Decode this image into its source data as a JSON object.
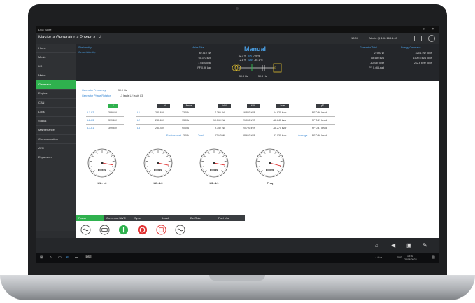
{
  "window": {
    "app_name": "DSE Suite",
    "minimize": "–",
    "maximize": "□",
    "close": "✕"
  },
  "topbar": {
    "breadcrumb": "Master > Generator > Power > L-L",
    "time": "13:00",
    "user": "Admin @ 192.168.1.63"
  },
  "sidebar": {
    "items": [
      {
        "label": "Home"
      },
      {
        "label": "Mimic"
      },
      {
        "label": "I/O"
      },
      {
        "label": "Mains"
      },
      {
        "label": "Generator",
        "active": true
      },
      {
        "label": "Engine"
      },
      {
        "label": "CAN"
      },
      {
        "label": "Logs"
      },
      {
        "label": "Status"
      },
      {
        "label": "Maintenance"
      },
      {
        "label": "Communication"
      },
      {
        "label": "AVR"
      },
      {
        "label": "Expansion"
      }
    ]
  },
  "header": {
    "site_identity": "Site identity:",
    "genset_identity": "Genset identity:",
    "mains_total_label": "Mains Total",
    "mains_total": [
      "62.510 kW",
      "65.370 kVA",
      "17.550 kvar",
      "PF 0.96 Lag"
    ],
    "mode": "Manual",
    "mimic_values": [
      "32.7 %",
      "kW",
      "7.9 %",
      "12.1 %",
      "kvar",
      "-30.1 %"
    ],
    "mimic_labels": {
      "hz_left": "50.3 Hz",
      "hz_right": "50.3 Hz",
      "gen": "G"
    },
    "generator_total_label": "Generator Total",
    "generator_total": [
      "27540 W",
      "58.660 kVA",
      "-52.030 kvar",
      "PF 0.46 Lead"
    ],
    "energy_label": "Energy Generator",
    "energy": [
      "425.1 kW hour",
      "1500.6 kVA hour",
      "212.6 kvar hour"
    ]
  },
  "main": {
    "freq_label": "Generator Frequency",
    "freq_value": "50.0 Hz",
    "phase_label": "Generator Phase Rotation",
    "phase_value": "L1 leads L2 leads L3",
    "ll_header": "L-L",
    "ll_rows": [
      {
        "label": "L1-L2",
        "value": "399.4 V"
      },
      {
        "label": "L2-L3",
        "value": "399.6 V"
      },
      {
        "label": "L3-L1",
        "value": "399.5 V"
      }
    ],
    "table_headers": [
      "L-N",
      "Amps",
      "kW",
      "kVA",
      "kvar",
      "pF"
    ],
    "rows": [
      {
        "phase": "L1",
        "ln": "230.6 V",
        "amps": "73.0 A",
        "kw": "7.760 kW",
        "kva": "16.820 kVA",
        "kvar": "-14.920 kvar",
        "pf": "PF 0.46 Lead"
      },
      {
        "phase": "L2",
        "ln": "230.6 V",
        "amps": "93.0 A",
        "kw": "10.040 kW",
        "kva": "21.060 kVA",
        "kvar": "-18.640 kvar",
        "pf": "PF 0.47 Lead"
      },
      {
        "phase": "L3",
        "ln": "230.4 V",
        "amps": "90.0 A",
        "kw": "9.740 kW",
        "kva": "20.700 kVA",
        "kvar": "-18.270 kvar",
        "pf": "PF 0.47 Lead"
      }
    ],
    "earth_label": "Earth current",
    "earth_value": "3.0 A",
    "total_label": "Total",
    "total_kw": "27540 W",
    "total_kva": "58.660 kVA",
    "total_kvar": "-52.030 kvar",
    "average_label": "Average",
    "average_pf": "PF 0.46 Lead",
    "gauges": [
      {
        "label": "L1 - L2",
        "readout": "399.4 V"
      },
      {
        "label": "L2 - L3",
        "readout": "399.6 V"
      },
      {
        "label": "L3 - L1",
        "readout": "399.5 V"
      },
      {
        "label": "Freq",
        "readout": "50.0 Hz"
      }
    ]
  },
  "tabs": [
    {
      "label": "Power",
      "active": true
    },
    {
      "label": "Governor / AVR"
    },
    {
      "label": "Sync"
    },
    {
      "label": "Load"
    },
    {
      "label": "De-Rate"
    },
    {
      "label": "Fuel Use"
    }
  ],
  "controls": [
    "mains-icon",
    "auto-icon",
    "start-icon",
    "stop-icon",
    "manual-icon",
    "generator-icon"
  ],
  "taskbar": {
    "language": "ENG",
    "clock_time": "13:00",
    "clock_date": "22/06/2022",
    "tray": "∧  ✉  ■"
  },
  "colors": {
    "accent_green": "#2fb14e",
    "accent_blue": "#4aa0e6",
    "stop_red": "#e03030",
    "gen_yellow": "#e0c030"
  }
}
